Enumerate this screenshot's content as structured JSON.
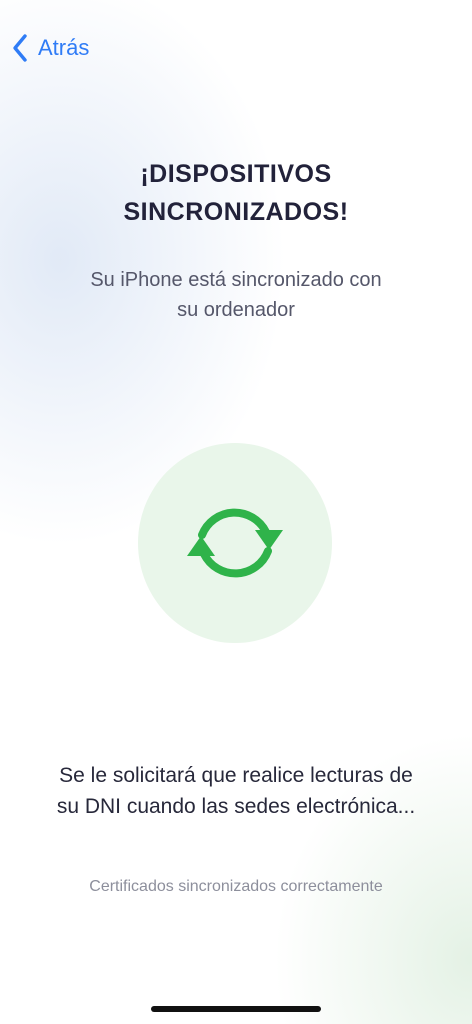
{
  "nav": {
    "back_label": "Atrás"
  },
  "title": {
    "line1": "¡DISPOSITIVOS",
    "line2": "SINCRONIZADOS!"
  },
  "subtitle": {
    "line1": "Su iPhone está sincronizado con",
    "line2": "su ordenador"
  },
  "sync": {
    "icon": "sync-icon",
    "color": "#2fb34a",
    "circle_color": "#e9f6ea"
  },
  "info": {
    "line1": "Se le solicitará que realice lecturas de",
    "line2": "su DNI cuando las sedes electrónica..."
  },
  "status": "Certificados sincronizados correctamente",
  "colors": {
    "accent": "#2f7cf6",
    "title": "#22223a"
  }
}
